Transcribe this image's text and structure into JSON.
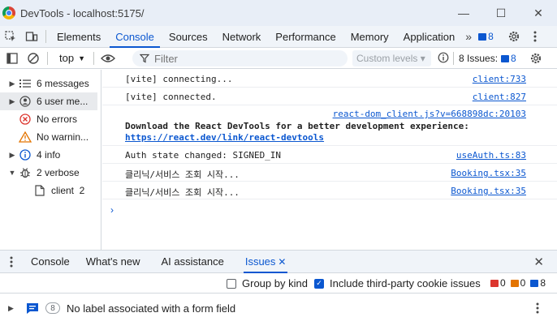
{
  "window": {
    "title": "DevTools - localhost:5175/",
    "minimize": "—",
    "maximize": "☐",
    "close": "✕"
  },
  "tabs": [
    "Elements",
    "Console",
    "Sources",
    "Network",
    "Performance",
    "Memory",
    "Application"
  ],
  "more_tabs": "»",
  "header_issue_count": "8",
  "console_toolbar": {
    "context": "top",
    "filter_placeholder": "Filter",
    "levels": "Custom levels ▾",
    "issues_label": "8 Issues:",
    "issues_count": "8"
  },
  "sidebar": [
    {
      "label": "6 messages",
      "arrow": "▶",
      "icon": "list-icon"
    },
    {
      "label": "6 user me...",
      "arrow": "▶",
      "icon": "user-icon"
    },
    {
      "label": "No errors",
      "arrow": "",
      "icon": "error-icon"
    },
    {
      "label": "No warnin...",
      "arrow": "",
      "icon": "warning-icon"
    },
    {
      "label": "4 info",
      "arrow": "▶",
      "icon": "info-icon"
    },
    {
      "label": "2 verbose",
      "arrow": "▼",
      "icon": "bug-icon"
    },
    {
      "label": "client  2",
      "arrow": "",
      "icon": "file-icon"
    }
  ],
  "messages": [
    {
      "text": "[vite] connecting...",
      "source": "client:733"
    },
    {
      "text": "[vite] connected.",
      "source": "client:827"
    },
    {
      "source": "react-dom_client.js?v=668898dc:20103",
      "bold_text": "Download the React DevTools for a better development experience:",
      "link": "https://react.dev/link/react-devtools"
    },
    {
      "text": "Auth state changed: SIGNED_IN",
      "source": "useAuth.ts:83"
    },
    {
      "text": "클리닉/서비스 조회 시작...",
      "source": "Booking.tsx:35"
    },
    {
      "text": "클리닉/서비스 조회 시작...",
      "source": "Booking.tsx:35"
    }
  ],
  "prompt": "›",
  "drawer": {
    "tabs": [
      "Console",
      "What's new",
      "AI assistance",
      "Issues"
    ],
    "active": "Issues",
    "close": "✕"
  },
  "issues_panel": {
    "group_by_kind": "Group by kind",
    "include_third_party": "Include third-party cookie issues",
    "error_count": "0",
    "warning_count": "0",
    "info_count": "8",
    "issue_row": {
      "count": "8",
      "title": "No label associated with a form field"
    }
  },
  "colors": {
    "accent": "#0b57d0",
    "error": "#dc362e",
    "warning": "#e37400"
  }
}
